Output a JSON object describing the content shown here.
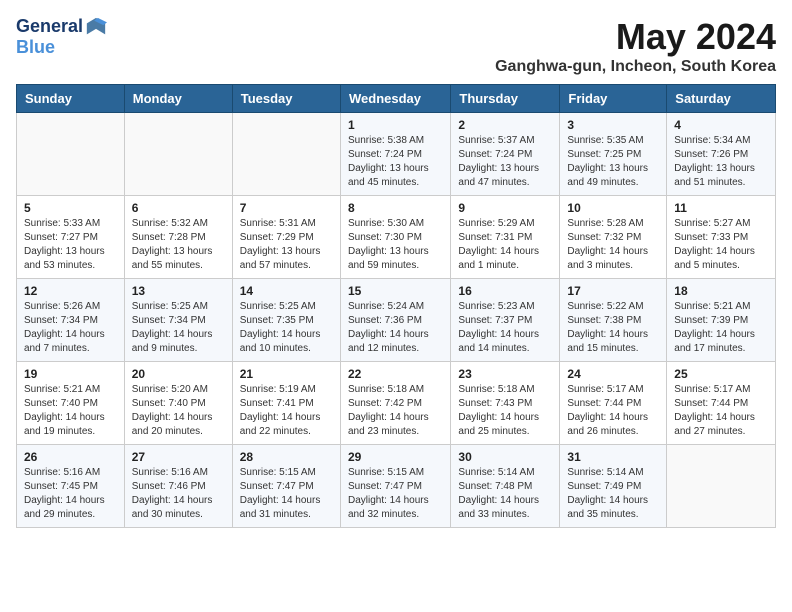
{
  "header": {
    "logo_line1": "General",
    "logo_line2": "Blue",
    "month_title": "May 2024",
    "location": "Ganghwa-gun, Incheon, South Korea"
  },
  "days_of_week": [
    "Sunday",
    "Monday",
    "Tuesday",
    "Wednesday",
    "Thursday",
    "Friday",
    "Saturday"
  ],
  "weeks": [
    [
      {
        "day": "",
        "sunrise": "",
        "sunset": "",
        "daylight": ""
      },
      {
        "day": "",
        "sunrise": "",
        "sunset": "",
        "daylight": ""
      },
      {
        "day": "",
        "sunrise": "",
        "sunset": "",
        "daylight": ""
      },
      {
        "day": "1",
        "sunrise": "5:38 AM",
        "sunset": "7:24 PM",
        "daylight": "13 hours and 45 minutes."
      },
      {
        "day": "2",
        "sunrise": "5:37 AM",
        "sunset": "7:24 PM",
        "daylight": "13 hours and 47 minutes."
      },
      {
        "day": "3",
        "sunrise": "5:35 AM",
        "sunset": "7:25 PM",
        "daylight": "13 hours and 49 minutes."
      },
      {
        "day": "4",
        "sunrise": "5:34 AM",
        "sunset": "7:26 PM",
        "daylight": "13 hours and 51 minutes."
      }
    ],
    [
      {
        "day": "5",
        "sunrise": "5:33 AM",
        "sunset": "7:27 PM",
        "daylight": "13 hours and 53 minutes."
      },
      {
        "day": "6",
        "sunrise": "5:32 AM",
        "sunset": "7:28 PM",
        "daylight": "13 hours and 55 minutes."
      },
      {
        "day": "7",
        "sunrise": "5:31 AM",
        "sunset": "7:29 PM",
        "daylight": "13 hours and 57 minutes."
      },
      {
        "day": "8",
        "sunrise": "5:30 AM",
        "sunset": "7:30 PM",
        "daylight": "13 hours and 59 minutes."
      },
      {
        "day": "9",
        "sunrise": "5:29 AM",
        "sunset": "7:31 PM",
        "daylight": "14 hours and 1 minute."
      },
      {
        "day": "10",
        "sunrise": "5:28 AM",
        "sunset": "7:32 PM",
        "daylight": "14 hours and 3 minutes."
      },
      {
        "day": "11",
        "sunrise": "5:27 AM",
        "sunset": "7:33 PM",
        "daylight": "14 hours and 5 minutes."
      }
    ],
    [
      {
        "day": "12",
        "sunrise": "5:26 AM",
        "sunset": "7:34 PM",
        "daylight": "14 hours and 7 minutes."
      },
      {
        "day": "13",
        "sunrise": "5:25 AM",
        "sunset": "7:34 PM",
        "daylight": "14 hours and 9 minutes."
      },
      {
        "day": "14",
        "sunrise": "5:25 AM",
        "sunset": "7:35 PM",
        "daylight": "14 hours and 10 minutes."
      },
      {
        "day": "15",
        "sunrise": "5:24 AM",
        "sunset": "7:36 PM",
        "daylight": "14 hours and 12 minutes."
      },
      {
        "day": "16",
        "sunrise": "5:23 AM",
        "sunset": "7:37 PM",
        "daylight": "14 hours and 14 minutes."
      },
      {
        "day": "17",
        "sunrise": "5:22 AM",
        "sunset": "7:38 PM",
        "daylight": "14 hours and 15 minutes."
      },
      {
        "day": "18",
        "sunrise": "5:21 AM",
        "sunset": "7:39 PM",
        "daylight": "14 hours and 17 minutes."
      }
    ],
    [
      {
        "day": "19",
        "sunrise": "5:21 AM",
        "sunset": "7:40 PM",
        "daylight": "14 hours and 19 minutes."
      },
      {
        "day": "20",
        "sunrise": "5:20 AM",
        "sunset": "7:40 PM",
        "daylight": "14 hours and 20 minutes."
      },
      {
        "day": "21",
        "sunrise": "5:19 AM",
        "sunset": "7:41 PM",
        "daylight": "14 hours and 22 minutes."
      },
      {
        "day": "22",
        "sunrise": "5:18 AM",
        "sunset": "7:42 PM",
        "daylight": "14 hours and 23 minutes."
      },
      {
        "day": "23",
        "sunrise": "5:18 AM",
        "sunset": "7:43 PM",
        "daylight": "14 hours and 25 minutes."
      },
      {
        "day": "24",
        "sunrise": "5:17 AM",
        "sunset": "7:44 PM",
        "daylight": "14 hours and 26 minutes."
      },
      {
        "day": "25",
        "sunrise": "5:17 AM",
        "sunset": "7:44 PM",
        "daylight": "14 hours and 27 minutes."
      }
    ],
    [
      {
        "day": "26",
        "sunrise": "5:16 AM",
        "sunset": "7:45 PM",
        "daylight": "14 hours and 29 minutes."
      },
      {
        "day": "27",
        "sunrise": "5:16 AM",
        "sunset": "7:46 PM",
        "daylight": "14 hours and 30 minutes."
      },
      {
        "day": "28",
        "sunrise": "5:15 AM",
        "sunset": "7:47 PM",
        "daylight": "14 hours and 31 minutes."
      },
      {
        "day": "29",
        "sunrise": "5:15 AM",
        "sunset": "7:47 PM",
        "daylight": "14 hours and 32 minutes."
      },
      {
        "day": "30",
        "sunrise": "5:14 AM",
        "sunset": "7:48 PM",
        "daylight": "14 hours and 33 minutes."
      },
      {
        "day": "31",
        "sunrise": "5:14 AM",
        "sunset": "7:49 PM",
        "daylight": "14 hours and 35 minutes."
      },
      {
        "day": "",
        "sunrise": "",
        "sunset": "",
        "daylight": ""
      }
    ]
  ]
}
